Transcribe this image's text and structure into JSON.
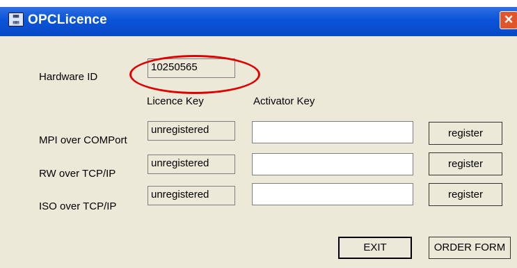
{
  "window": {
    "title": "OPCLicence",
    "icon": "opc-app-icon",
    "close_icon": "close-icon"
  },
  "hardware": {
    "label": "Hardware ID",
    "value": "10250565"
  },
  "columns": {
    "licence_key": "Licence Key",
    "activator_key": "Activator Key"
  },
  "rows": [
    {
      "label": "MPI over COMPort",
      "licence": "unregistered",
      "activator": "",
      "button": "register"
    },
    {
      "label": "RW over TCP/IP",
      "licence": "unregistered",
      "activator": "",
      "button": "register"
    },
    {
      "label": "ISO over TCP/IP",
      "licence": "unregistered",
      "activator": "",
      "button": "register"
    }
  ],
  "buttons": {
    "exit": "EXIT",
    "order_form": "ORDER FORM"
  },
  "annotation_color": "#e00000"
}
